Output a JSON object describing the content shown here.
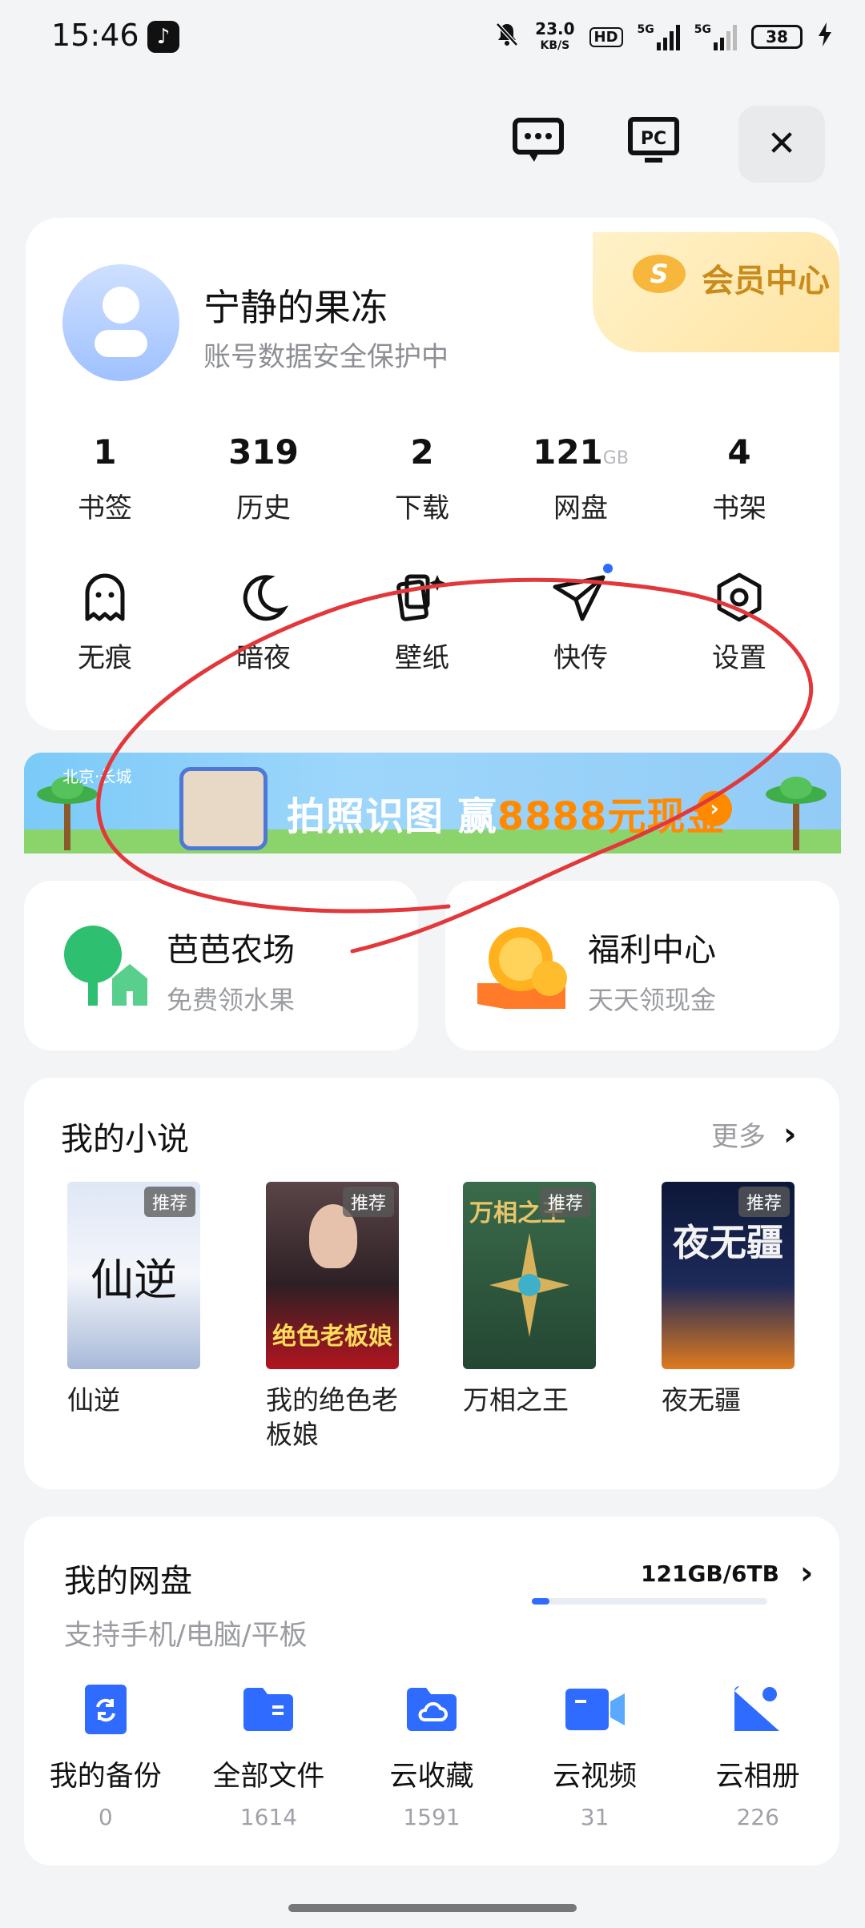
{
  "status_bar": {
    "time": "15:46",
    "net_speed": "23.0",
    "net_unit": "KB/S",
    "hd": "HD",
    "sig1": "5G",
    "sig2": "5G",
    "battery": "38"
  },
  "profile": {
    "name": "宁静的果冻",
    "subtitle": "账号数据安全保护中",
    "vip_label": "会员中心"
  },
  "stats": [
    {
      "value": "1",
      "unit": "",
      "label": "书签"
    },
    {
      "value": "319",
      "unit": "",
      "label": "历史"
    },
    {
      "value": "2",
      "unit": "",
      "label": "下载"
    },
    {
      "value": "121",
      "unit": "GB",
      "label": "网盘"
    },
    {
      "value": "4",
      "unit": "",
      "label": "书架"
    }
  ],
  "tools": [
    {
      "label": "无痕",
      "icon": "ghost-icon"
    },
    {
      "label": "暗夜",
      "icon": "moon-icon"
    },
    {
      "label": "壁纸",
      "icon": "wallpaper-icon"
    },
    {
      "label": "快传",
      "icon": "send-icon"
    },
    {
      "label": "设置",
      "icon": "settings-icon"
    }
  ],
  "banner": {
    "location": "北京·长城",
    "text_a": "拍照识图 赢",
    "text_b": "8888元现金"
  },
  "promos": [
    {
      "title": "芭芭农场",
      "subtitle": "免费领水果"
    },
    {
      "title": "福利中心",
      "subtitle": "天天领现金"
    }
  ],
  "novels": {
    "title": "我的小说",
    "more": "更多",
    "tag": "推荐",
    "books": [
      {
        "title": "仙逆",
        "cover_text": "仙逆",
        "colors": [
          "#e9eef8",
          "#7f98c6"
        ]
      },
      {
        "title": "我的绝色老板娘",
        "cover_text": "绝色老板娘",
        "colors": [
          "#3a2a2e",
          "#c0182a"
        ]
      },
      {
        "title": "万相之王",
        "cover_text": "万相之王",
        "colors": [
          "#2f5b3c",
          "#1b3a27"
        ]
      },
      {
        "title": "夜无疆",
        "cover_text": "夜无疆",
        "colors": [
          "#0f1b3c",
          "#d86b1e"
        ]
      }
    ]
  },
  "netdisk": {
    "title": "我的网盘",
    "subtitle": "支持手机/电脑/平板",
    "usage": "121GB/6TB",
    "usage_fraction": 0.02,
    "items": [
      {
        "label": "我的备份",
        "count": "0",
        "icon": "backup-icon"
      },
      {
        "label": "全部文件",
        "count": "1614",
        "icon": "folder-icon"
      },
      {
        "label": "云收藏",
        "count": "1591",
        "icon": "cloud-folder-icon"
      },
      {
        "label": "云视频",
        "count": "31",
        "icon": "video-icon"
      },
      {
        "label": "云相册",
        "count": "226",
        "icon": "album-icon"
      }
    ]
  },
  "colors": {
    "accent": "#2f6bff",
    "vip_gold": "#c98c1c",
    "annotation_red": "#e2383b"
  }
}
